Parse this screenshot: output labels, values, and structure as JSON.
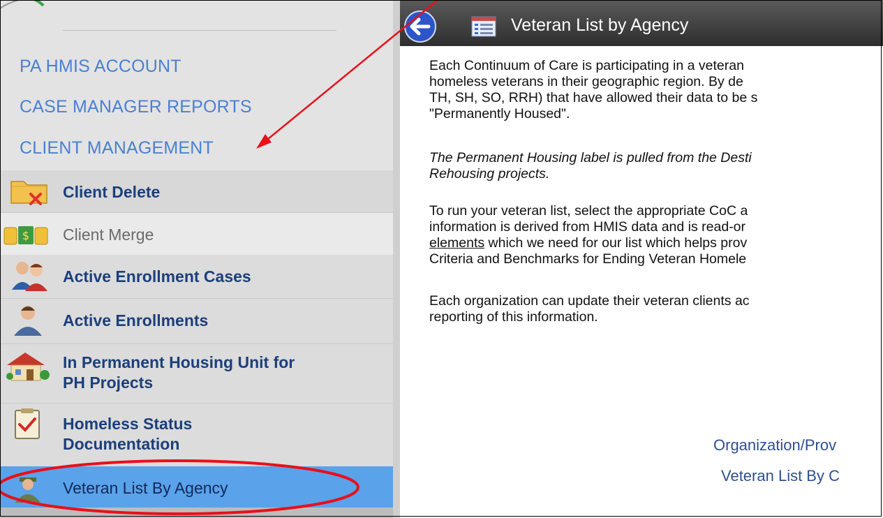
{
  "sidebar": {
    "top_links": [
      {
        "label": "PA HMIS ACCOUNT"
      },
      {
        "label": "CASE MANAGER REPORTS"
      },
      {
        "label": "CLIENT MANAGEMENT"
      }
    ],
    "items": [
      {
        "label": "Client Delete",
        "icon": "folder-delete-icon",
        "state": "normal"
      },
      {
        "label": "Client Merge",
        "icon": "merge-coins-icon",
        "state": "disabled"
      },
      {
        "label": "Active Enrollment Cases",
        "icon": "people-icon",
        "state": "normal"
      },
      {
        "label": "Active Enrollments",
        "icon": "person-icon",
        "state": "normal"
      },
      {
        "label_line1": "In Permanent Housing Unit for",
        "label_line2": "PH Projects",
        "icon": "house-icon",
        "state": "normal"
      },
      {
        "label_line1": "Homeless Status",
        "label_line2": "Documentation",
        "icon": "checklist-icon",
        "state": "normal"
      },
      {
        "label": "Veteran List By Agency",
        "icon": "veteran-icon",
        "state": "selected"
      }
    ]
  },
  "header": {
    "title": "Veteran List by Agency",
    "back_icon": "back-arrow-icon",
    "title_icon": "list-icon"
  },
  "content": {
    "p1": [
      "Each Continuum of Care is participating in a veteran",
      "homeless veterans in their geographic region.  By de",
      "TH, SH, SO, RRH) that have allowed their data to be s",
      "\"Permanently Housed\"."
    ],
    "p2": [
      "The Permanent Housing label is pulled from the Desti",
      "Rehousing projects."
    ],
    "p3_line1": "To run your veteran list, select the appropriate CoC a",
    "p3_line2": "information is derived from HMIS data and is read-or",
    "p3_line3_link": "elements",
    "p3_line3_rest": " which we need for our list which helps prov",
    "p3_line4": "Criteria and Benchmarks for Ending Veteran Homele",
    "p4": [
      "Each organization can update their veteran clients ac",
      "reporting of this information."
    ],
    "links": [
      {
        "label": "Organization/Prov"
      },
      {
        "label": "Veteran List By C"
      }
    ]
  },
  "colors": {
    "link_blue": "#4a80d4",
    "menu_text": "#1c3f7a",
    "selected_bg": "#5aa2ea",
    "annotation_red": "#e8101a"
  }
}
